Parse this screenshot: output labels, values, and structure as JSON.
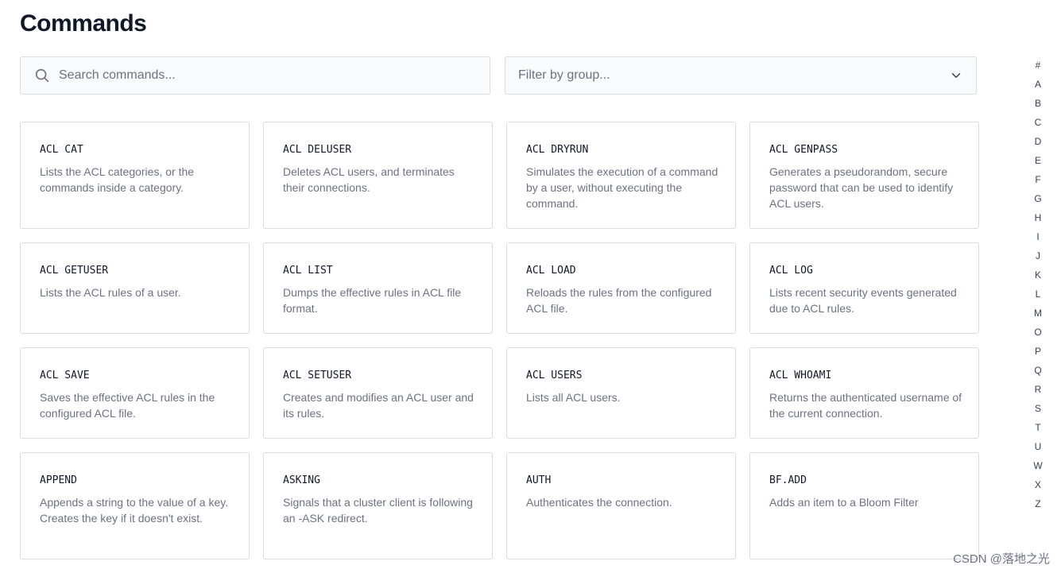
{
  "page": {
    "title": "Commands"
  },
  "search": {
    "placeholder": "Search commands...",
    "icon": "search-icon"
  },
  "filter": {
    "placeholder": "Filter by group...",
    "icon": "chevron-down-icon"
  },
  "commands": [
    {
      "name": "ACL CAT",
      "description": "Lists the ACL categories, or the commands inside a category."
    },
    {
      "name": "ACL DELUSER",
      "description": "Deletes ACL users, and terminates their connections."
    },
    {
      "name": "ACL DRYRUN",
      "description": "Simulates the execution of a command by a user, without executing the command."
    },
    {
      "name": "ACL GENPASS",
      "description": "Generates a pseudorandom, secure password that can be used to identify ACL users."
    },
    {
      "name": "ACL GETUSER",
      "description": "Lists the ACL rules of a user."
    },
    {
      "name": "ACL LIST",
      "description": "Dumps the effective rules in ACL file format."
    },
    {
      "name": "ACL LOAD",
      "description": "Reloads the rules from the configured ACL file."
    },
    {
      "name": "ACL LOG",
      "description": "Lists recent security events generated due to ACL rules."
    },
    {
      "name": "ACL SAVE",
      "description": "Saves the effective ACL rules in the configured ACL file."
    },
    {
      "name": "ACL SETUSER",
      "description": "Creates and modifies an ACL user and its rules."
    },
    {
      "name": "ACL USERS",
      "description": "Lists all ACL users."
    },
    {
      "name": "ACL WHOAMI",
      "description": "Returns the authenticated username of the current connection."
    },
    {
      "name": "APPEND",
      "description": "Appends a string to the value of a key. Creates the key if it doesn't exist."
    },
    {
      "name": "ASKING",
      "description": "Signals that a cluster client is following an -ASK redirect."
    },
    {
      "name": "AUTH",
      "description": "Authenticates the connection."
    },
    {
      "name": "BF.ADD",
      "description": "Adds an item to a Bloom Filter"
    }
  ],
  "alphabet": [
    "#",
    "A",
    "B",
    "C",
    "D",
    "E",
    "F",
    "G",
    "H",
    "I",
    "J",
    "K",
    "L",
    "M",
    "O",
    "P",
    "Q",
    "R",
    "S",
    "T",
    "U",
    "W",
    "X",
    "Z"
  ],
  "watermark": "CSDN @落地之光",
  "colors": {
    "border": "#d9dde3",
    "input_bg": "#f8fafc",
    "text_primary": "#111827",
    "text_secondary": "#6b7280"
  }
}
